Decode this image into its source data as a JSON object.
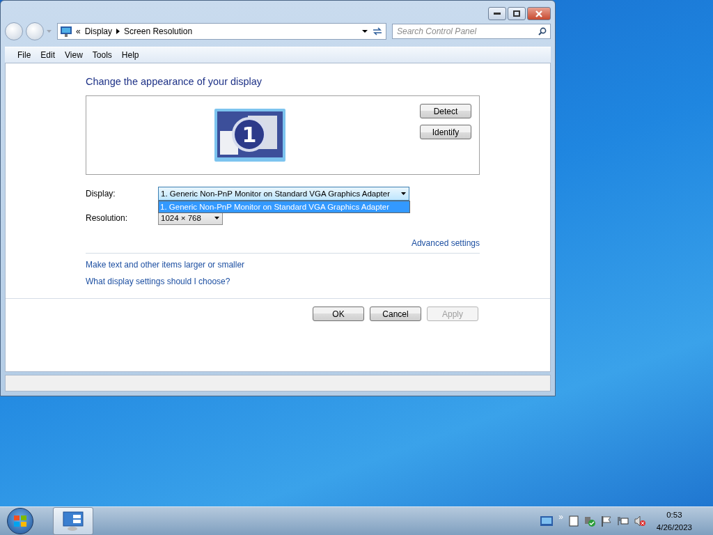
{
  "address": {
    "overflow": "«",
    "crumbs": [
      "Display",
      "Screen Resolution"
    ]
  },
  "search": {
    "placeholder": "Search Control Panel"
  },
  "menu": [
    "File",
    "Edit",
    "View",
    "Tools",
    "Help"
  ],
  "heading": "Change the appearance of your display",
  "monitor": {
    "number": "1",
    "selected": true
  },
  "preview_buttons": [
    {
      "label": "Detect"
    },
    {
      "label": "Identify"
    }
  ],
  "display_field": {
    "label": "Display:",
    "value": "1. Generic Non-PnP Monitor on Standard VGA Graphics Adapter",
    "expanded": true,
    "options": [
      {
        "label": "1. Generic Non-PnP Monitor on Standard VGA Graphics Adapter",
        "selected": true
      }
    ]
  },
  "resolution_field": {
    "label": "Resolution:",
    "value": "1024 × 768"
  },
  "advanced_link": "Advanced settings",
  "links": [
    "Make text and other items larger or smaller",
    "What display settings should I choose?"
  ],
  "buttons": [
    {
      "label": "OK",
      "disabled": false
    },
    {
      "label": "Cancel",
      "disabled": false
    },
    {
      "label": "Apply",
      "disabled": true
    }
  ],
  "tray": {
    "chevron": "»",
    "time": "0:53",
    "date": "4/26/2023"
  }
}
